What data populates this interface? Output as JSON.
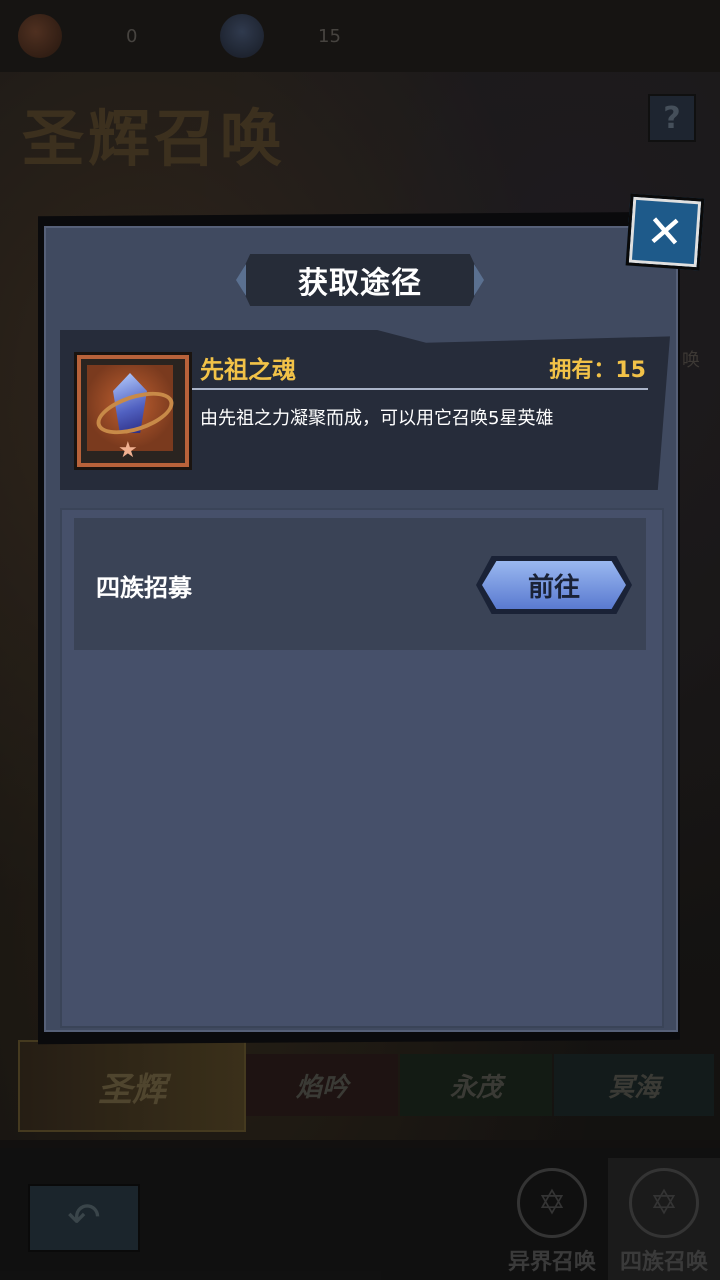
{
  "background": {
    "currencies": [
      {
        "icon": "scroll-icon",
        "value": "0"
      },
      {
        "icon": "soul-crystal-icon",
        "value": "15"
      }
    ],
    "screen_title": "圣辉召唤",
    "help_label": "?",
    "side_label": "召唤",
    "factions": [
      "圣辉",
      "焰吟",
      "永茂",
      "冥海"
    ],
    "tabs": [
      {
        "label": "异界召唤",
        "icon": "summon-circle-icon"
      },
      {
        "label": "四族召唤",
        "icon": "summon-circle-icon"
      }
    ]
  },
  "dialog": {
    "title": "获取途径",
    "close_label": "✕",
    "item": {
      "name": "先祖之魂",
      "owned_text": "拥有：15",
      "description": "由先祖之力凝聚而成，可以用它召唤5星英雄",
      "icon": "ancestor-soul-crystal-icon"
    },
    "sources": [
      {
        "label": "四族招募",
        "button_label": "前往"
      }
    ]
  }
}
